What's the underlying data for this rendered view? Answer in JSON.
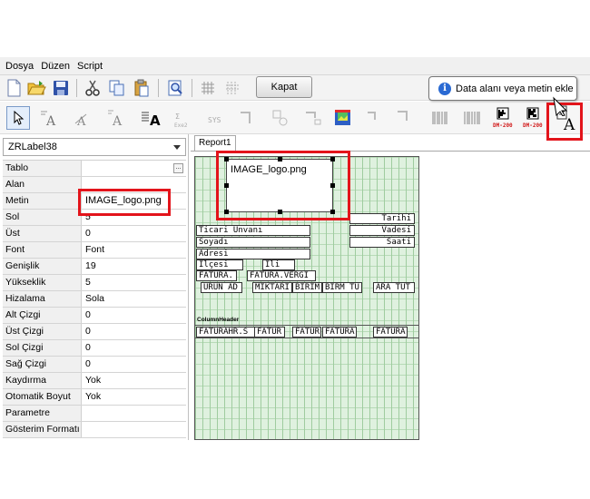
{
  "menu": {
    "items": [
      "Dosya",
      "Düzen",
      "Script"
    ]
  },
  "toolbar": {
    "close_label": "Kapat"
  },
  "tooltip": {
    "text": "Data alanı veya metin ekle"
  },
  "tools": {
    "barcode_label": "DM-200"
  },
  "inspector": {
    "selected_component": "ZRLabel38",
    "properties": [
      {
        "name": "Tablo",
        "value": ""
      },
      {
        "name": "Alan",
        "value": ""
      },
      {
        "name": "Metin",
        "value": "IMAGE_logo.png"
      },
      {
        "name": "Sol",
        "value": "5"
      },
      {
        "name": "Üst",
        "value": "0"
      },
      {
        "name": "Font",
        "value": "Font"
      },
      {
        "name": "Genişlik",
        "value": "19"
      },
      {
        "name": "Yükseklik",
        "value": "5"
      },
      {
        "name": "Hizalama",
        "value": "Sola"
      },
      {
        "name": "Alt Çizgi",
        "value": "0"
      },
      {
        "name": "Üst Çizgi",
        "value": "0"
      },
      {
        "name": "Sol Çizgi",
        "value": "0"
      },
      {
        "name": "Sağ Çizgi",
        "value": "0"
      },
      {
        "name": "Kaydırma",
        "value": "Yok"
      },
      {
        "name": "Otomatik Boyut",
        "value": "Yok"
      },
      {
        "name": "Parametre",
        "value": ""
      },
      {
        "name": "Gösterim Formatı",
        "value": ""
      }
    ]
  },
  "designer": {
    "tab": "Report1",
    "image_label": "IMAGE_logo.png",
    "fields": {
      "tarihi": "Tarihi",
      "vadesi": "Vadesi",
      "saati": "Saati",
      "ticari_unvani": "Ticari Unvanı",
      "soyadi": "Soyadı",
      "adresi": "Adresi",
      "ilcesi": "İlçesi",
      "ili": "İli",
      "fatura1": "FATURA.",
      "fatura_vergi": "FATURA.VERGİ",
      "urun_adi": "ÜRÜN AD",
      "miktari": "MİKTARI",
      "birimi": "BİRİM",
      "birim_tu": "BİRM TU",
      "ara_tut": "ARA TUT",
      "column_header": "ColumnHeader",
      "faturahr": "FATURAHR.S",
      "fatur1": "FATUR",
      "fatur2": "FATUR",
      "fatura2": "FATURA",
      "fatura3": "FATURA"
    }
  }
}
